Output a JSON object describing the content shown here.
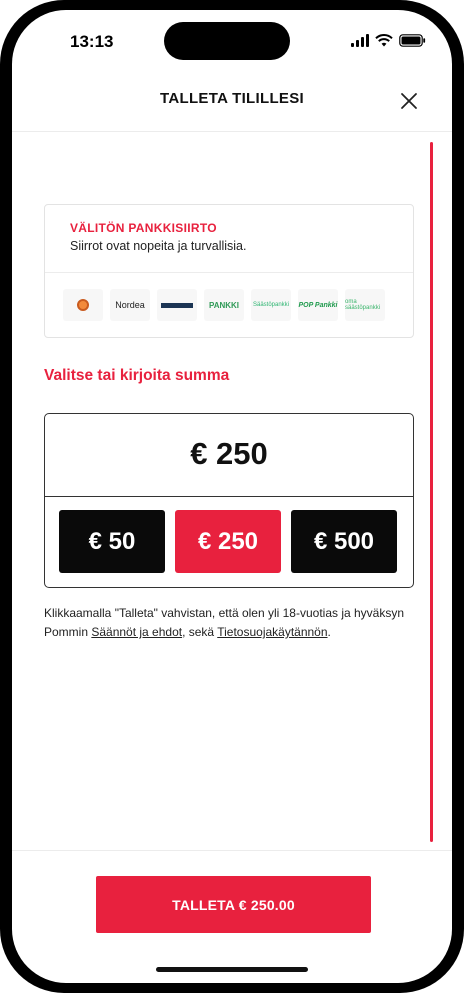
{
  "status_bar": {
    "time": "13:13"
  },
  "header": {
    "title": "TALLETA TILILLESI"
  },
  "bank_card": {
    "title": "VÄLITÖN PANKKISIIRTO",
    "subtitle": "Siirrot ovat nopeita ja turvallisia.",
    "banks": [
      "op-bank-logo",
      "Nordea",
      "danske-bank-logo",
      "PANKKI",
      "Säästöpankki",
      "POP Pankki",
      "oma säästöpankki"
    ]
  },
  "amount": {
    "heading": "Valitse tai kirjoita summa",
    "value": "€ 250",
    "presets": [
      "€ 50",
      "€ 250",
      "€ 500"
    ],
    "selected": "€ 250"
  },
  "terms": {
    "text_1": "Klikkaamalla \"Talleta\" vahvistan, että olen yli 18-vuotias ja hyväksyn Pommin ",
    "link_1": "Säännöt ja ehdot",
    "text_2": ", sekä ",
    "link_2": "Tietosuojakäytännön",
    "text_3": "."
  },
  "footer": {
    "deposit_label": "TALLETA € 250.00"
  },
  "colors": {
    "accent": "#e8213e",
    "dark": "#0a0a0a"
  }
}
